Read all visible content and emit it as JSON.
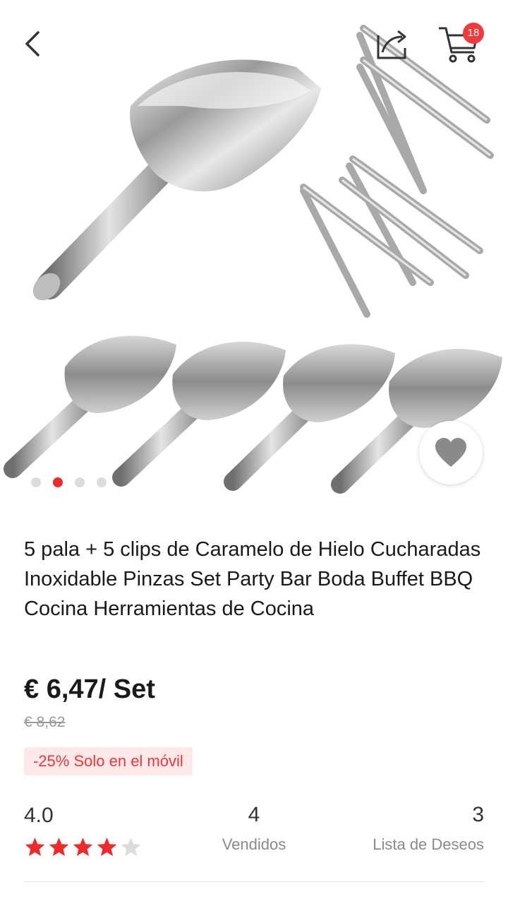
{
  "header": {
    "back_icon": "chevron-left-icon",
    "share_icon": "share-icon",
    "cart_icon": "cart-icon",
    "cart_count": "18"
  },
  "gallery": {
    "image_count": 4,
    "active_index": 1,
    "wishlist_icon": "heart-icon"
  },
  "product": {
    "title": "5 pala + 5 clips de Caramelo de Hielo Cucharadas Inoxidable Pinzas Set Party Bar Boda Buffet BBQ Cocina Herramientas de Cocina",
    "price": "€ 6,47/ Set",
    "old_price": "€ 8,62",
    "discount_label": "-25% Solo en el móvil"
  },
  "stats": {
    "rating": "4.0",
    "stars_filled": 4,
    "stars_total": 5,
    "sold_count": "4",
    "sold_label": "Vendidos",
    "wishlist_count": "3",
    "wishlist_label": "Lista de Deseos"
  },
  "colors": {
    "accent": "#f02a2a",
    "badge_bg": "#fde9e9",
    "star_empty": "#dcdcdc"
  }
}
